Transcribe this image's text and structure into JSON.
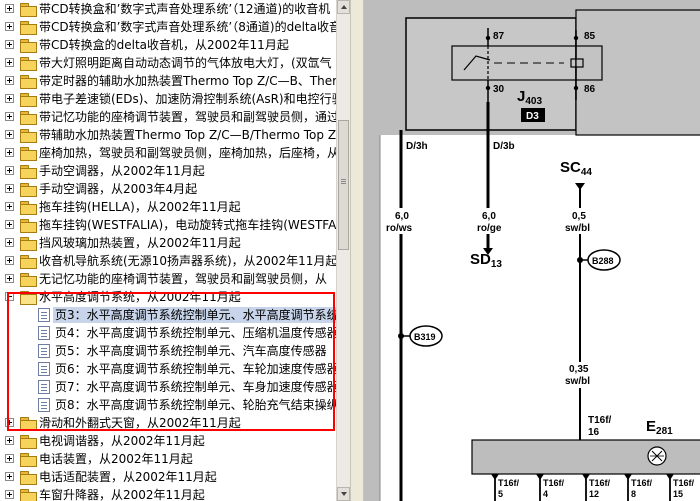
{
  "tree": {
    "items": [
      {
        "label": "带CD转换盒和’数字式声音处理系统’（12通道)的收音机",
        "type": "folder"
      },
      {
        "label": "带CD转换盒和’数字式声音处理系统’（8通道)的delta收音机",
        "type": "folder"
      },
      {
        "label": "带CD转换盒的delta收音机，从2002年11月起",
        "type": "folder"
      },
      {
        "label": "带大灯照明距离自动动态调节的气体放电大灯，(双氙气",
        "type": "folder"
      },
      {
        "label": "带定时器的辅助水加热装置Thermo Top Z/C—B、Ther",
        "type": "folder"
      },
      {
        "label": "带电子差速锁(EDs)、加速防滑控制系统(AsR)和电控行驶",
        "type": "folder"
      },
      {
        "label": "带记忆功能的座椅调节装置，驾驶员和副驾驶员侧，通过",
        "type": "folder"
      },
      {
        "label": "带辅助水加热装置Thermo Top Z/C—B/Thermo Top Z",
        "type": "folder"
      },
      {
        "label": "座椅加热，驾驶员和副驾驶员侧，座椅加热，后座椅，从",
        "type": "folder"
      },
      {
        "label": "手动空调器，从2002年11月起",
        "type": "folder"
      },
      {
        "label": "手动空调器，从2003年4月起",
        "type": "folder"
      },
      {
        "label": "拖车挂钩(HELLA)，从2002年11月起",
        "type": "folder"
      },
      {
        "label": "拖车挂钩(WESTFALIA)，电动旋转式拖车挂钩(WESTFA",
        "type": "folder"
      },
      {
        "label": "挡风玻璃加热装置，从2002年11月起",
        "type": "folder"
      },
      {
        "label": "收音机导航系统(无源10扬声器系统)，从2002年11月起",
        "type": "folder"
      },
      {
        "label": "无记忆功能的座椅调节装置，驾驶员和副驾驶员侧，从",
        "type": "folder"
      },
      {
        "label": "水平高度调节系统，从2002年11月起",
        "type": "folder-open"
      },
      {
        "label": "页3：水平高度调节系统控制单元、水平高度调节系统",
        "type": "page",
        "selected": true
      },
      {
        "label": "页4：水平高度调节系统控制单元、压缩机温度传感器",
        "type": "page"
      },
      {
        "label": "页5：水平高度调节系统控制单元、汽车高度传感器",
        "type": "page"
      },
      {
        "label": "页6：水平高度调节系统控制单元、车轮加速度传感器",
        "type": "page"
      },
      {
        "label": "页7：水平高度调节系统控制单元、车身加速度传感器",
        "type": "page"
      },
      {
        "label": "页8：水平高度调节系统控制单元、轮胎充气结束操纵",
        "type": "page"
      },
      {
        "label": "滑动和外翻式天窗，从2002年11月起",
        "type": "folder"
      },
      {
        "label": "电视调谐器，从2002年11月起",
        "type": "folder"
      },
      {
        "label": "电话装置，从2002年11月起",
        "type": "folder"
      },
      {
        "label": "电话适配装置，从2002年11月起",
        "type": "folder"
      },
      {
        "label": "车窗升降器，从2002年11月起",
        "type": "folder"
      }
    ]
  },
  "schematic": {
    "relay_pins": {
      "p87": "87",
      "p85": "85",
      "p30": "30",
      "p86": "86"
    },
    "relay_name": "J",
    "relay_sub": "403",
    "relay_slot": "D3",
    "wires": [
      {
        "tag": "D/3h",
        "gauge": "6,0",
        "color": "ro/ws"
      },
      {
        "tag": "D/3b",
        "gauge": "6,0",
        "color": "ro/ge"
      }
    ],
    "sd_label": "SD",
    "sd_sub": "13",
    "sc_label": "SC",
    "sc_sub": "44",
    "sc_wire": {
      "gauge": "0,5",
      "color": "sw/bl"
    },
    "connectors": {
      "b288": "B288",
      "b319": "B319"
    },
    "sc_wire2": {
      "gauge": "0,35",
      "color": "sw/bl"
    },
    "t16_top": {
      "name": "T16f/",
      "pin": "16"
    },
    "e_label": "E",
    "e_sub": "281",
    "bottom_terms": [
      {
        "name": "T16f/",
        "pin": "5"
      },
      {
        "name": "T16f/",
        "pin": "4"
      },
      {
        "name": "T16f/",
        "pin": "12"
      },
      {
        "name": "T16f/",
        "pin": "8"
      },
      {
        "name": "T16f/",
        "pin": "15"
      }
    ]
  }
}
